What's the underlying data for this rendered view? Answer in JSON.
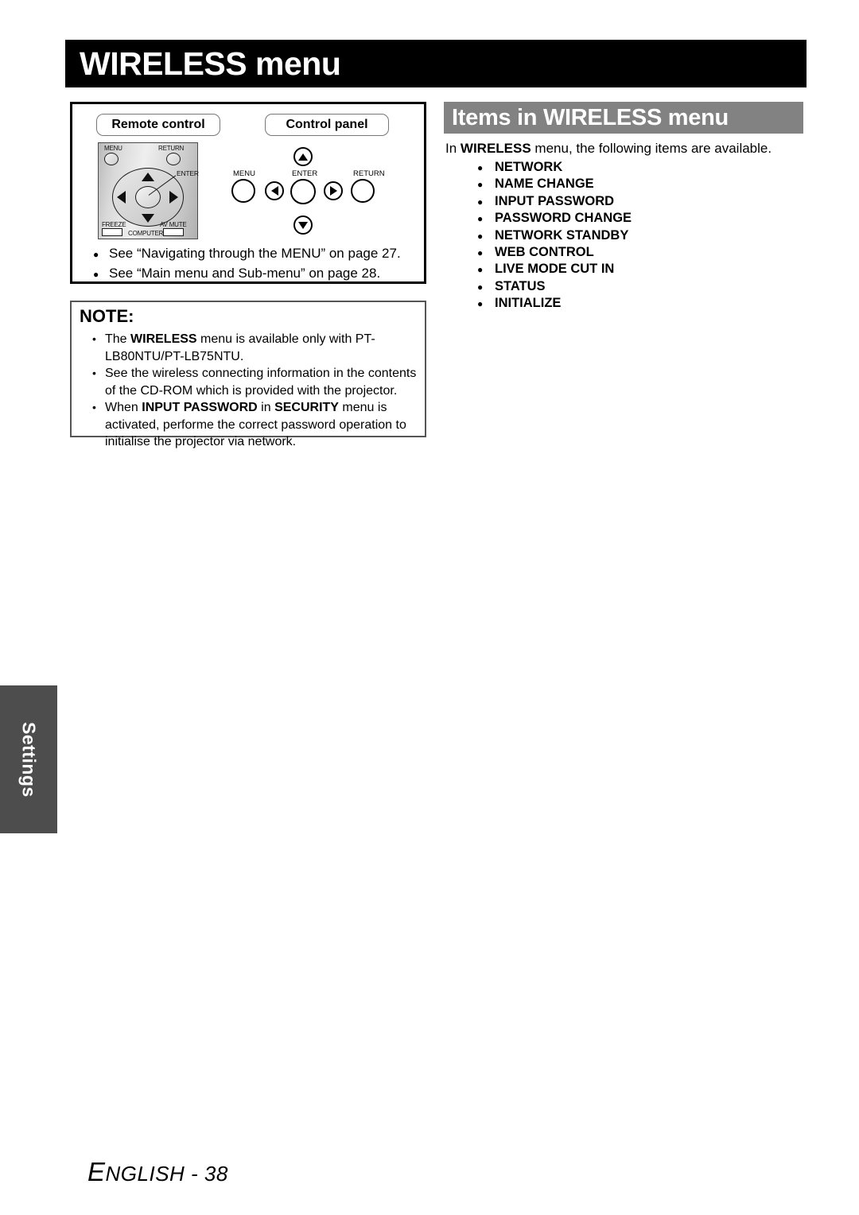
{
  "page": {
    "title": "WIRELESS menu",
    "title_bold_part": "WIRELESS",
    "title_rest": "menu",
    "footer_lead": "E",
    "footer_rest": "NGLISH - 38",
    "side_tab_label": "Settings"
  },
  "diagram_panel": {
    "remote_control_label": "Remote control",
    "control_panel_label": "Control panel",
    "remote": {
      "menu_label": "MENU",
      "return_label": "RETURN",
      "enter_label": "ENTER",
      "freeze_label": "FREEZE",
      "avmute_label": "AV MUTE",
      "computer_label": "COMPUTER"
    },
    "panel": {
      "menu_label": "MENU",
      "enter_label": "ENTER",
      "return_label": "RETURN"
    },
    "see_also": [
      {
        "bullet": "●",
        "text": "See “Navigating through the MENU” on page 27."
      },
      {
        "bullet": "●",
        "text": "See “Main menu and Sub-menu” on page 28."
      }
    ]
  },
  "note": {
    "heading": "NOTE:",
    "bullet": "•",
    "items": [
      {
        "segments": [
          {
            "text": "The ",
            "bold": false
          },
          {
            "text": "WIRELESS",
            "bold": true
          },
          {
            "text": " menu is available only with PT-LB80NTU/PT-LB75NTU.",
            "bold": false
          }
        ]
      },
      {
        "segments": [
          {
            "text": "See the wireless connecting information in the contents of the CD-ROM which is provided with the projector.",
            "bold": false
          }
        ]
      },
      {
        "segments": [
          {
            "text": "When ",
            "bold": false
          },
          {
            "text": "INPUT PASSWORD",
            "bold": true
          },
          {
            "text": " in ",
            "bold": false
          },
          {
            "text": "SECURITY",
            "bold": true
          },
          {
            "text": " menu is activated, performe the correct password operation to initialise the projector via network.",
            "bold": false
          }
        ]
      }
    ]
  },
  "items_section": {
    "header": "Items in WIRELESS menu",
    "intro_segments": [
      {
        "text": "In ",
        "bold": false
      },
      {
        "text": "WIRELESS",
        "bold": true
      },
      {
        "text": " menu, the following items are available.",
        "bold": false
      }
    ],
    "bullet": "●",
    "items": [
      "NETWORK",
      "NAME CHANGE",
      "INPUT PASSWORD",
      "PASSWORD CHANGE",
      "NETWORK STANDBY",
      "WEB CONTROL",
      "LIVE MODE CUT IN",
      "STATUS",
      "INITIALIZE"
    ]
  },
  "colors": {
    "title_bar_bg": "#000000",
    "items_header_bg": "#828282",
    "side_tab_bg": "#4d4d4d",
    "text": "#000000",
    "page_bg": "#ffffff"
  }
}
